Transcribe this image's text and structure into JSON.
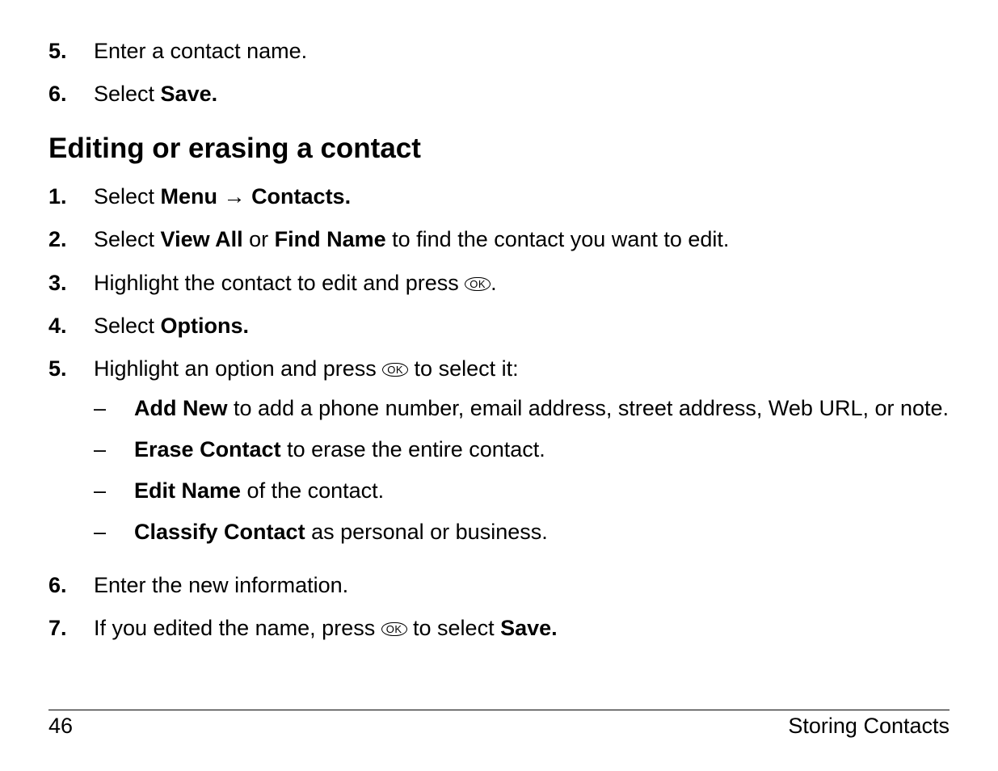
{
  "top_steps": [
    {
      "num": "5.",
      "segments": [
        {
          "t": "Enter a contact name."
        }
      ]
    },
    {
      "num": "6.",
      "segments": [
        {
          "t": "Select "
        },
        {
          "t": "Save.",
          "bold": true
        }
      ]
    }
  ],
  "section_heading": "Editing or erasing a contact",
  "main_steps": [
    {
      "num": "1.",
      "segments": [
        {
          "t": "Select "
        },
        {
          "t": "Menu",
          "bold": true
        },
        {
          "t": " → ",
          "arrow": true
        },
        {
          "t": "Contacts.",
          "bold": true
        }
      ]
    },
    {
      "num": "2.",
      "segments": [
        {
          "t": "Select "
        },
        {
          "t": "View All",
          "bold": true
        },
        {
          "t": " or "
        },
        {
          "t": "Find Name",
          "bold": true
        },
        {
          "t": " to find the contact you want to edit."
        }
      ]
    },
    {
      "num": "3.",
      "segments": [
        {
          "t": "Highlight the contact to edit and press "
        },
        {
          "ok": true
        },
        {
          "t": "."
        }
      ]
    },
    {
      "num": "4.",
      "segments": [
        {
          "t": "Select "
        },
        {
          "t": "Options.",
          "bold": true
        }
      ]
    },
    {
      "num": "5.",
      "segments": [
        {
          "t": "Highlight an option and press "
        },
        {
          "ok": true
        },
        {
          "t": " to select it:"
        }
      ],
      "subitems": [
        [
          {
            "t": "Add New",
            "bold": true
          },
          {
            "t": " to add a phone number, email address, street address, Web URL, or note."
          }
        ],
        [
          {
            "t": "Erase Contact",
            "bold": true
          },
          {
            "t": " to erase the entire contact."
          }
        ],
        [
          {
            "t": "Edit Name",
            "bold": true
          },
          {
            "t": " of the contact."
          }
        ],
        [
          {
            "t": "Classify Contact",
            "bold": true
          },
          {
            "t": " as personal or business."
          }
        ]
      ]
    },
    {
      "num": "6.",
      "segments": [
        {
          "t": "Enter the new information."
        }
      ]
    },
    {
      "num": "7.",
      "segments": [
        {
          "t": "If you edited the name, press "
        },
        {
          "ok": true
        },
        {
          "t": " to select "
        },
        {
          "t": "Save.",
          "bold": true
        }
      ]
    }
  ],
  "ok_label": "OK",
  "footer": {
    "page_number": "46",
    "section": "Storing Contacts"
  }
}
